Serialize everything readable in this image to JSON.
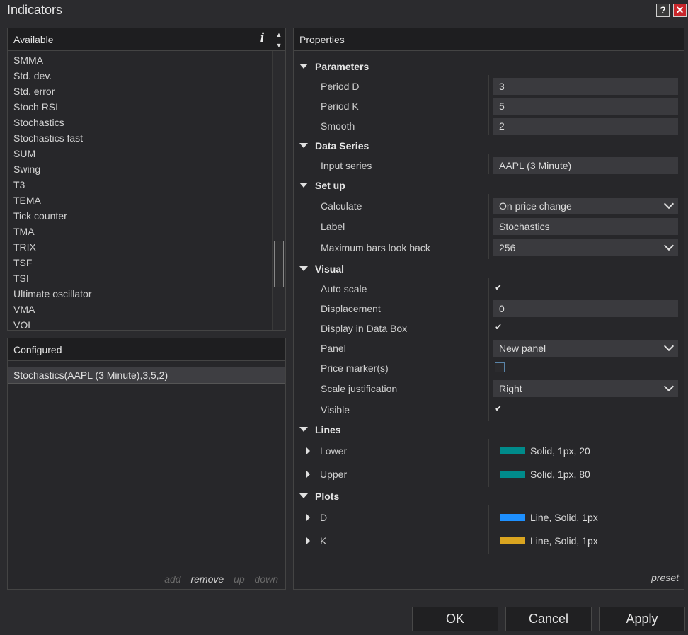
{
  "window": {
    "title": "Indicators",
    "help_label": "?",
    "close_label": "✕"
  },
  "available": {
    "header": "Available",
    "info_label": "i",
    "items": [
      "SMMA",
      "Std. dev.",
      "Std. error",
      "Stoch RSI",
      "Stochastics",
      "Stochastics fast",
      "SUM",
      "Swing",
      "T3",
      "TEMA",
      "Tick counter",
      "TMA",
      "TRIX",
      "TSF",
      "TSI",
      "Ultimate oscillator",
      "VMA",
      "VOL"
    ]
  },
  "configured": {
    "header": "Configured",
    "items": [
      "Stochastics(AAPL (3 Minute),3,5,2)"
    ],
    "actions": {
      "add": "add",
      "remove": "remove",
      "up": "up",
      "down": "down"
    }
  },
  "properties": {
    "header": "Properties",
    "sections": {
      "parameters": "Parameters",
      "data_series": "Data Series",
      "setup": "Set up",
      "visual": "Visual",
      "lines": "Lines",
      "plots": "Plots"
    },
    "params": {
      "period_d": {
        "label": "Period D",
        "value": "3"
      },
      "period_k": {
        "label": "Period K",
        "value": "5"
      },
      "smooth": {
        "label": "Smooth",
        "value": "2"
      }
    },
    "data_series": {
      "input_series": {
        "label": "Input series",
        "value": "AAPL (3 Minute)"
      }
    },
    "setup": {
      "calculate": {
        "label": "Calculate",
        "value": "On price change"
      },
      "label": {
        "label": "Label",
        "value": "Stochastics"
      },
      "max_bars": {
        "label": "Maximum bars look back",
        "value": "256"
      }
    },
    "visual": {
      "auto_scale": {
        "label": "Auto scale",
        "checked": true
      },
      "displacement": {
        "label": "Displacement",
        "value": "0"
      },
      "display_data_box": {
        "label": "Display in Data Box",
        "checked": true
      },
      "panel": {
        "label": "Panel",
        "value": "New panel"
      },
      "price_markers": {
        "label": "Price marker(s)",
        "checked": false
      },
      "scale_justification": {
        "label": "Scale justification",
        "value": "Right"
      },
      "visible": {
        "label": "Visible",
        "checked": true
      }
    },
    "lines": {
      "lower": {
        "label": "Lower",
        "value": "Solid, 1px, 20",
        "color": "#008b8b"
      },
      "upper": {
        "label": "Upper",
        "value": "Solid, 1px, 80",
        "color": "#008b8b"
      }
    },
    "plots": {
      "d": {
        "label": "D",
        "value": "Line, Solid, 1px",
        "color": "#1e90ff"
      },
      "k": {
        "label": "K",
        "value": "Line, Solid, 1px",
        "color": "#daa520"
      }
    },
    "preset": "preset"
  },
  "buttons": {
    "ok": "OK",
    "cancel": "Cancel",
    "apply": "Apply"
  }
}
